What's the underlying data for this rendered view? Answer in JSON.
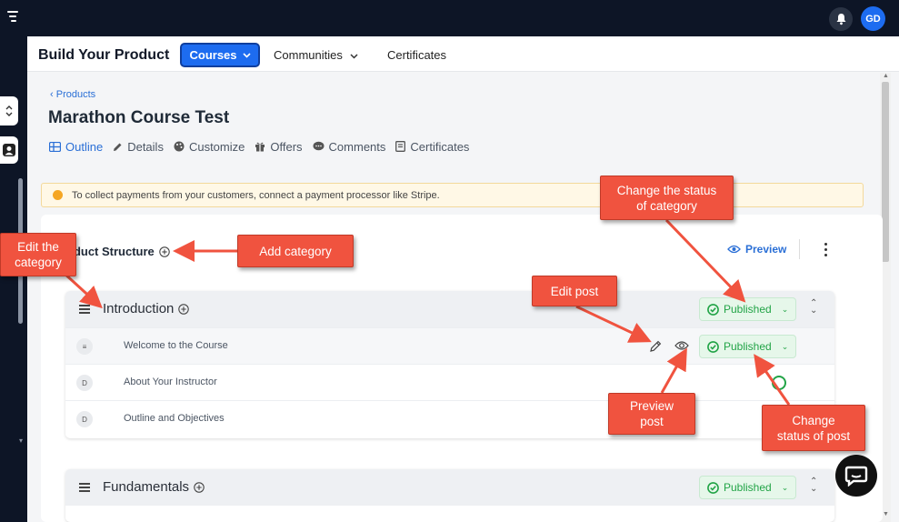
{
  "topbar": {
    "avatar_initials": "GD"
  },
  "header": {
    "title": "Build Your Product",
    "courses_label": "Courses",
    "communities_label": "Communities",
    "certificates_label": "Certificates"
  },
  "breadcrumb": "Products",
  "page_title": "Marathon Course Test",
  "tabs": [
    {
      "label": "Outline",
      "icon": "outline-icon",
      "active": true
    },
    {
      "label": "Details",
      "icon": "pencil-icon"
    },
    {
      "label": "Customize",
      "icon": "palette-icon"
    },
    {
      "label": "Offers",
      "icon": "gift-icon"
    },
    {
      "label": "Comments",
      "icon": "comment-icon"
    },
    {
      "label": "Certificates",
      "icon": "certificate-icon"
    }
  ],
  "alert": {
    "text": "To collect payments from your customers, connect a payment processor like Stripe."
  },
  "structure": {
    "label": "oduct Structure",
    "preview_label": "Preview",
    "categories": [
      {
        "name": "Introduction",
        "status": "Published",
        "posts": [
          {
            "icon_letter": "≡",
            "title": "Welcome to the Course",
            "status": "Published"
          },
          {
            "icon_letter": "D",
            "title": "About Your Instructor"
          },
          {
            "icon_letter": "D",
            "title": "Outline and Objectives"
          }
        ]
      },
      {
        "name": "Fundamentals",
        "status": "Published"
      }
    ]
  },
  "callouts": {
    "edit_category": [
      "Edit the",
      "category"
    ],
    "add_category": "Add category",
    "change_category_status": [
      "Change the status",
      "of category"
    ],
    "edit_post": "Edit post",
    "preview_post": [
      "Preview",
      "post"
    ],
    "change_post_status": [
      "Change",
      "status of post"
    ]
  },
  "colors": {
    "topbar": "#0d1526",
    "accent": "#1d6cf0",
    "published_green": "#22a447",
    "callout": "#f0533f"
  }
}
